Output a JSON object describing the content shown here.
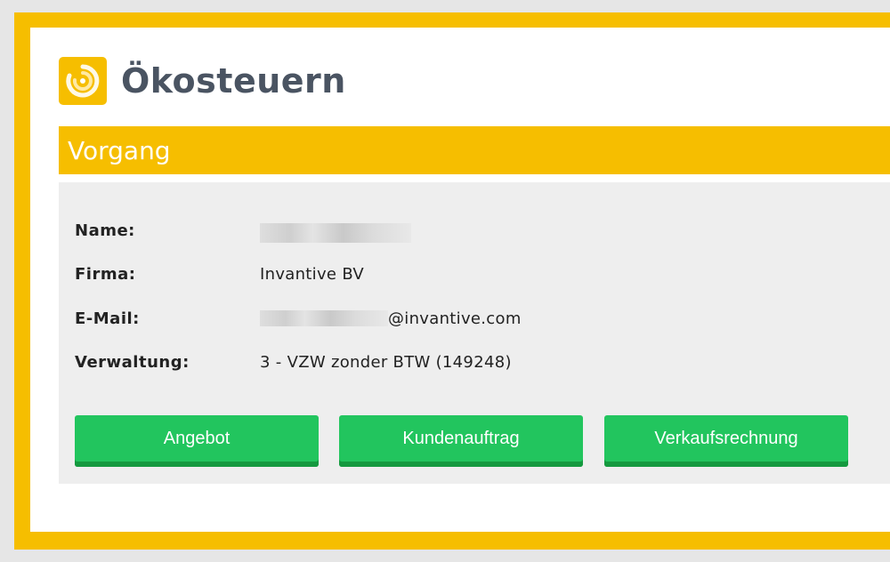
{
  "app": {
    "title": "Ökosteuern",
    "logo_icon": "swirl-logo-icon",
    "accent_color": "#f6be00"
  },
  "section": {
    "title": "Vorgang"
  },
  "fields": {
    "name_label": "Name:",
    "name_value": "",
    "firma_label": "Firma:",
    "firma_value": "Invantive BV",
    "email_label": "E-Mail:",
    "email_domain": "@invantive.com",
    "verwaltung_label": "Verwaltung:",
    "verwaltung_value": "3 - VZW zonder BTW (149248)"
  },
  "buttons": {
    "angebot": "Angebot",
    "kundenauftrag": "Kundenauftrag",
    "verkaufsrechnung": "Verkaufsrechnung",
    "color": "#22c55e"
  }
}
